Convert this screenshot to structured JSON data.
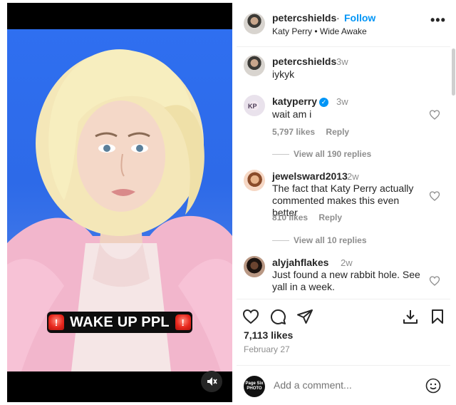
{
  "video": {
    "caption": "WAKE UP PPL",
    "caption_emoji_icon": "police-light-icon",
    "mute_icon": "speaker-muted-icon"
  },
  "header": {
    "username": "petercshields",
    "separator": "·",
    "follow_label": "Follow",
    "audio": "Katy Perry • Wide Awake",
    "more_icon": "more-horizontal-icon",
    "more_label": "•••"
  },
  "comments": [
    {
      "username": "petercshields",
      "time": "3w",
      "text": "iykyk"
    },
    {
      "username": "katyperry",
      "verified": true,
      "time": "3w",
      "text": "wait am i",
      "likes": "5,797 likes",
      "reply_label": "Reply",
      "view_replies": "View all 190 replies"
    },
    {
      "username": "jewelsward2013",
      "time": "2w",
      "text": "The fact that Katy Perry actually commented makes this even better",
      "likes": "810 likes",
      "reply_label": "Reply",
      "view_replies": "View all 10 replies"
    },
    {
      "username": "alyjahflakes",
      "time": "2w",
      "text": "Just found a new rabbit hole. See yall in a week."
    }
  ],
  "actions": {
    "likes": "7,113 likes",
    "date": "February 27"
  },
  "add_comment": {
    "placeholder": "Add a comment...",
    "avatar_text": "Page Six PHOTO"
  },
  "colors": {
    "accent": "#0095f6",
    "muted": "#8e8e8e",
    "text": "#262626"
  }
}
